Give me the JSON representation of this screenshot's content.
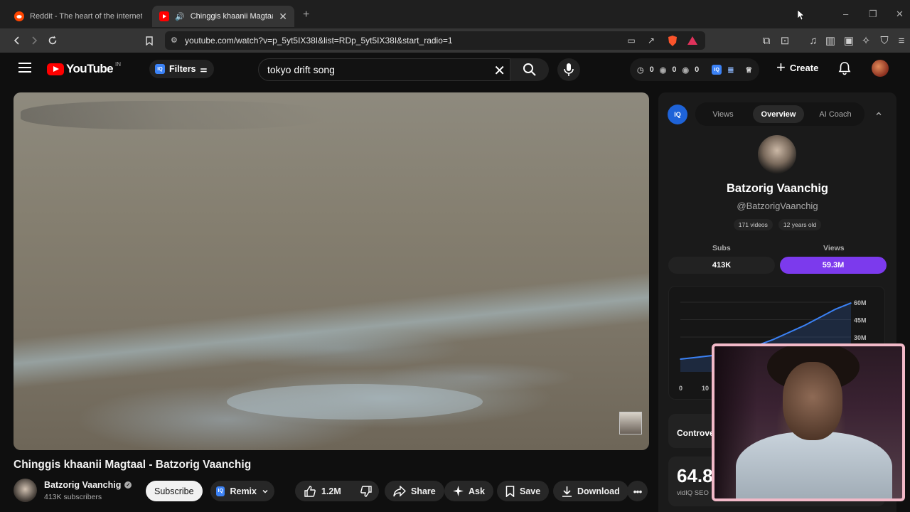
{
  "browser": {
    "tabs": [
      {
        "title": "Reddit - The heart of the internet",
        "active": false
      },
      {
        "title": "Chinggis khaanii Magtaal - Ba",
        "active": true
      }
    ],
    "new_tab": "+",
    "url": "youtube.com/watch?v=p_5yt5IX38I&list=RDp_5yt5IX38I&start_radio=1"
  },
  "youtube": {
    "logo": "YouTube",
    "country": "IN",
    "filters_label": "Filters",
    "search_value": "tokyo drift song",
    "stats": [
      "0",
      "0",
      "0"
    ],
    "create_label": "Create"
  },
  "video": {
    "title": "Chinggis khaanii Magtaal - Batzorig Vaanchig",
    "channel": "Batzorig Vaanchig",
    "subscribers": "413K subscribers",
    "subscribe_label": "Subscribe",
    "remix_label": "Remix",
    "likes": "1.2M",
    "share_label": "Share",
    "ask_label": "Ask",
    "save_label": "Save",
    "download_label": "Download"
  },
  "vidiq": {
    "logo": "IQ",
    "tabs": [
      "Views",
      "Overview",
      "AI Coach"
    ],
    "active_tab": "Overview",
    "channel_name": "Batzorig Vaanchig",
    "handle": "@BatzorigVaanchig",
    "videos": "171 videos",
    "age": "12 years old",
    "subs_label": "Subs",
    "subs_value": "413K",
    "views_label": "Views",
    "views_value": "59.3M",
    "accent_color": "#7c3aed",
    "controversy_label": "Controve",
    "seo_score": "64.8",
    "seo_label": "vidIQ SEO"
  },
  "chart_data": {
    "type": "line",
    "title": "",
    "xlabel": "",
    "ylabel": "",
    "x_ticks": [
      "0",
      "10"
    ],
    "y_ticks": [
      "60M",
      "45M",
      "30M"
    ],
    "ylim": [
      0,
      60000000
    ],
    "series": [
      {
        "values": [
          11000000,
          12500000,
          14000000,
          16000000,
          19000000,
          23000000,
          28000000,
          34000000,
          40000000,
          47000000,
          54000000,
          59300000
        ]
      }
    ],
    "color": "#3b82f6"
  }
}
